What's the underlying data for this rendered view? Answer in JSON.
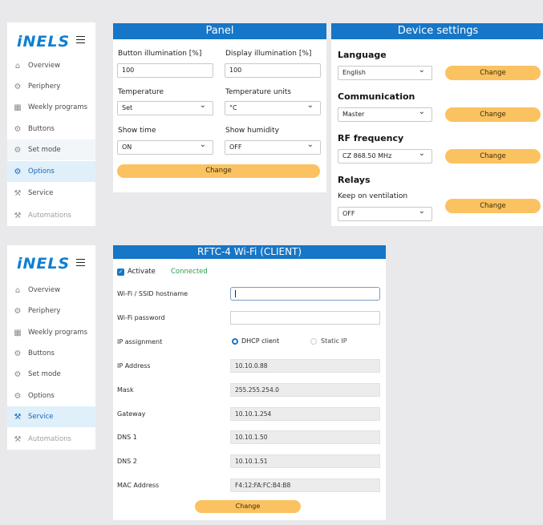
{
  "logo": "iNELS",
  "nav": {
    "items": [
      "Overview",
      "Periphery",
      "Weekly programs",
      "Buttons",
      "Set mode",
      "Options",
      "Service",
      "Automations"
    ]
  },
  "panel": {
    "title": "Panel",
    "button_illumination_label": "Button illumination [%]",
    "button_illumination_value": "100",
    "display_illumination_label": "Display illumination [%]",
    "display_illumination_value": "100",
    "temperature_label": "Temperature",
    "temperature_value": "Set",
    "temperature_units_label": "Temperature units",
    "temperature_units_value": "°C",
    "show_time_label": "Show time",
    "show_time_value": "ON",
    "show_humidity_label": "Show humidity",
    "show_humidity_value": "OFF",
    "change_label": "Change"
  },
  "device": {
    "title": "Device settings",
    "language_header": "Language",
    "language_value": "English",
    "communication_header": "Communication",
    "communication_value": "Master",
    "rf_header": "RF frequency",
    "rf_value": "CZ 868.50 MHz",
    "relays_header": "Relays",
    "keep_label": "Keep on ventilation",
    "keep_value": "OFF",
    "change_label": "Change"
  },
  "wifi": {
    "title": "RFTC-4 Wi-Fi (CLIENT)",
    "activate_label": "Activate",
    "status": "Connected",
    "ssid_label": "Wi-Fi / SSID hostname",
    "ssid_value": "",
    "password_label": "Wi-Fi password",
    "password_value": "",
    "ip_assignment_label": "IP assignment",
    "dhcp_label": "DHCP client",
    "static_label": "Static IP",
    "ip_label": "IP Address",
    "ip_value": "10.10.0.88",
    "mask_label": "Mask",
    "mask_value": "255.255.254.0",
    "gateway_label": "Gateway",
    "gateway_value": "10.10.1.254",
    "dns1_label": "DNS 1",
    "dns1_value": "10.10.1.50",
    "dns2_label": "DNS 2",
    "dns2_value": "10.10.1.51",
    "mac_label": "MAC Address",
    "mac_value": "F4:12:FA:FC:B4:B8",
    "change_label": "Change"
  },
  "colors": {
    "primary": "#1676c7",
    "accent": "#fbc261",
    "status_ok": "#2e9c4a",
    "active_nav": "#dff0fb"
  }
}
